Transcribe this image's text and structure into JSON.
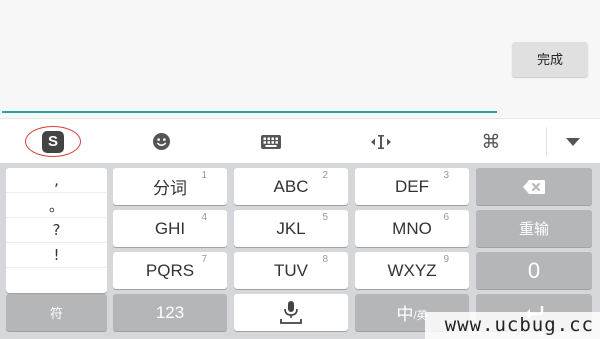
{
  "input": {
    "done_label": "完成"
  },
  "toolbar": {
    "logo_letter": "S",
    "logo_icon": "sogou-logo-icon",
    "emoji_icon": "emoji-face-icon",
    "keyboard_icon": "keyboard-icon",
    "cursor_icon": "cursor-move-icon",
    "cmd_icon": "command-icon",
    "cmd_glyph": "⌘",
    "dropdown_icon": "dropdown-arrow-icon"
  },
  "keyboard": {
    "punctuation": [
      ",",
      "。",
      "?",
      "!"
    ],
    "keys": {
      "fenci": {
        "label": "分词",
        "num": "1"
      },
      "abc": {
        "label": "ABC",
        "num": "2"
      },
      "def": {
        "label": "DEF",
        "num": "3"
      },
      "ghi": {
        "label": "GHI",
        "num": "4"
      },
      "jkl": {
        "label": "JKL",
        "num": "5"
      },
      "mno": {
        "label": "MNO",
        "num": "6"
      },
      "pqrs": {
        "label": "PQRS",
        "num": "7"
      },
      "tuv": {
        "label": "TUV",
        "num": "8"
      },
      "wxyz": {
        "label": "WXYZ",
        "num": "9"
      }
    },
    "backspace_icon": "backspace-icon",
    "reenter_label": "重输",
    "zero_label": "0",
    "symbol_label": "符",
    "num_label": "123",
    "space_icon": "microphone-space-icon",
    "lang_main": "中",
    "lang_sub": "/英",
    "enter_icon": "enter-icon"
  },
  "watermark": "www.ucbug.cc",
  "colors": {
    "accent": "#26a69a",
    "logo_ring": "#d9403a",
    "key_light": "#ffffff",
    "key_dark": "#b5b6b8",
    "keyboard_bg": "#d5d7da"
  }
}
